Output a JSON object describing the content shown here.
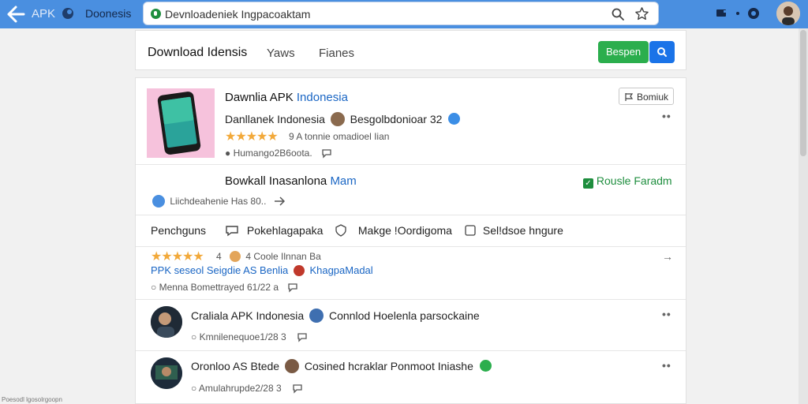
{
  "topbar": {
    "app_name": "APK",
    "app_name2": "Doonesis",
    "url": "Devnloadeniek Ingpacoaktam"
  },
  "tabs": {
    "active": "Download Idensis",
    "tab2": "Yaws",
    "tab3": "Fianes",
    "green_button": "Bespen"
  },
  "card": {
    "title_black": "Dawnlia APK",
    "title_blue": "Indonesia",
    "byline": "Danllanek Indonesia",
    "author": "Besgolbdonioar 32",
    "rating_note": "9 A tonnie omadioel Iian",
    "meta": "Humango2B6oota.",
    "follow_button": "Bomiuk"
  },
  "row2": {
    "title_black": "Bowkall Inasanlona",
    "title_blue": "Mam",
    "badge": "Rousle Faradm",
    "meta": "Liichdeahenie Has 80.."
  },
  "row3": {
    "label": "Penchguns",
    "action1": "Pokehlagapaka",
    "action2": "Makge !Oordigoma",
    "action3": "Sel!dsoe hngure"
  },
  "row4": {
    "rating_num": "4",
    "rating_text": "4 Coole Ilnnan Ba",
    "line2_a": "PPK seseol Seigdie",
    "line2_b": "AS Benlia",
    "line2_c": "KhagpaMadal",
    "meta": "Menna Bomettrayed 61/22 a"
  },
  "row5": {
    "name": "Craliala APK Indonesia",
    "text": "Connlod Hoelenla parsockaine",
    "meta": "Kmnilenequoe1/28 3"
  },
  "row6": {
    "name": "Oronloo AS Btede",
    "text": "Cosined hcraklar Ponmoot Iniashe",
    "meta": "Amulahrupde2/28 3"
  },
  "footer": "Poesodl lgosolrgoopn",
  "icons": {
    "back": "arrow-left-icon",
    "search": "search-icon",
    "star": "star-icon",
    "more": "kebab-icon",
    "comment": "comment-icon",
    "share": "share-icon",
    "verified": "verified-icon"
  },
  "colors": {
    "topbar": "#4a8fe0",
    "green": "#2bae4d",
    "blue": "#1a73e8",
    "link": "#1a66c4",
    "star": "#f2a93a"
  }
}
